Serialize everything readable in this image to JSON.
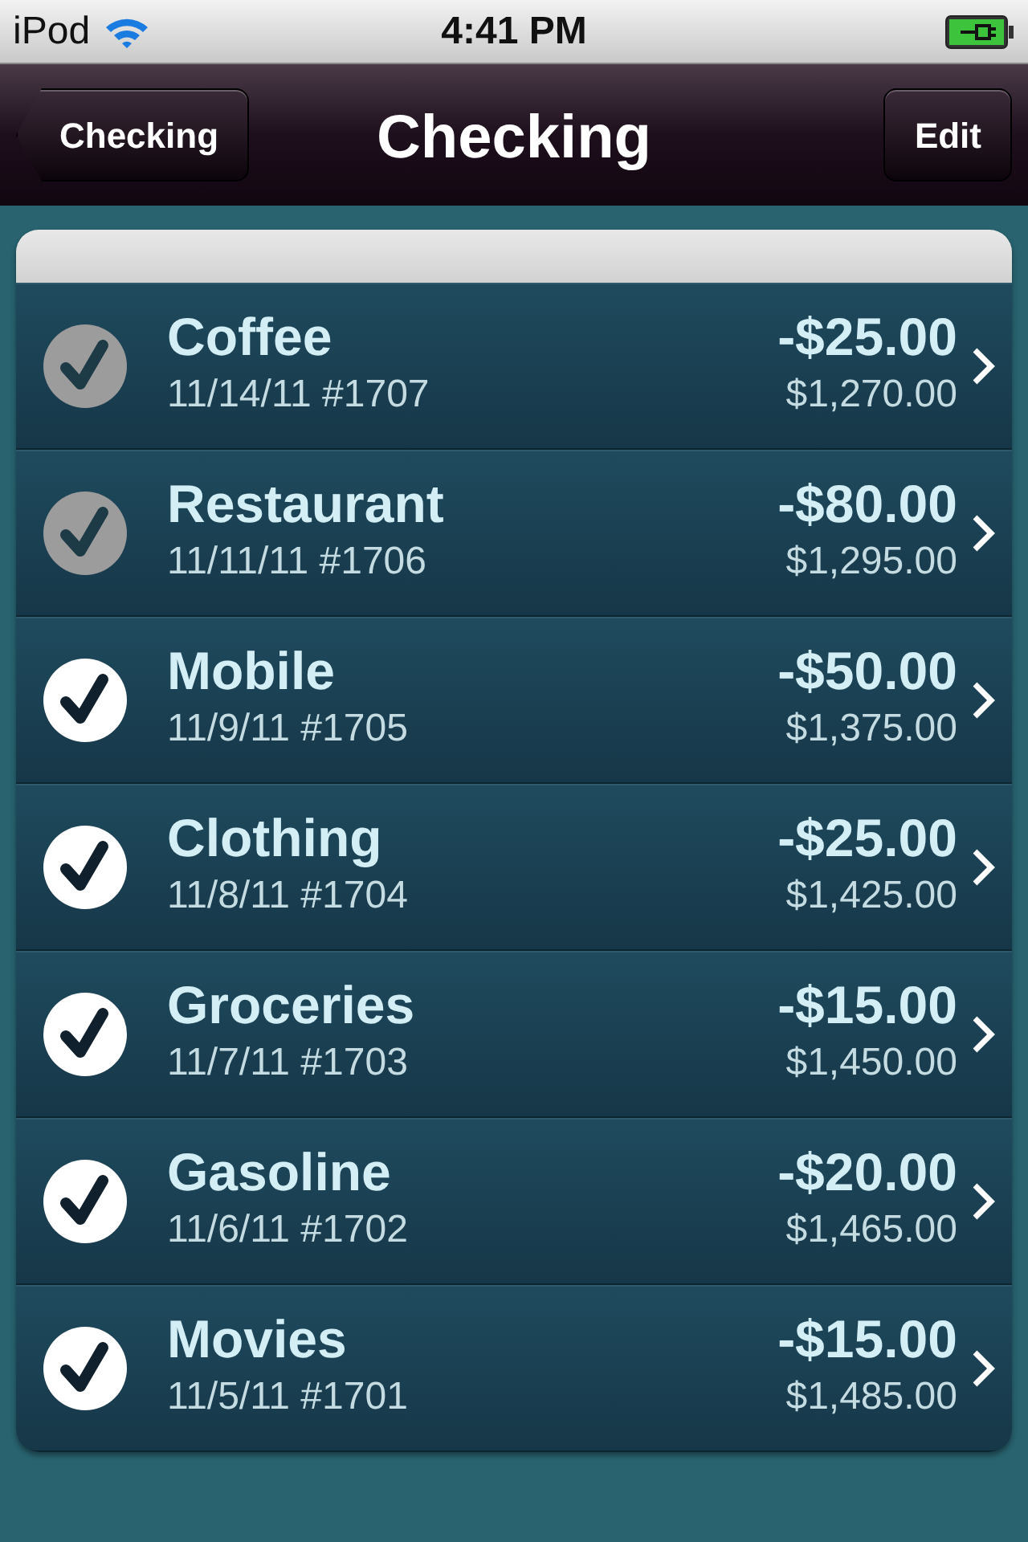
{
  "status_bar": {
    "carrier": "iPod",
    "time": "4:41 PM"
  },
  "nav_bar": {
    "back": "Checking",
    "title": "Checking",
    "edit": "Edit"
  },
  "transactions": [
    {
      "name": "Coffee",
      "date": "11/14/11 #1707",
      "amount": "-$25.00",
      "balance": "$1,270.00",
      "reconciled": true
    },
    {
      "name": "Restaurant",
      "date": "11/11/11 #1706",
      "amount": "-$80.00",
      "balance": "$1,295.00",
      "reconciled": true
    },
    {
      "name": "Mobile",
      "date": "11/9/11 #1705",
      "amount": "-$50.00",
      "balance": "$1,375.00",
      "reconciled": false
    },
    {
      "name": "Clothing",
      "date": "11/8/11 #1704",
      "amount": "-$25.00",
      "balance": "$1,425.00",
      "reconciled": false
    },
    {
      "name": "Groceries",
      "date": "11/7/11 #1703",
      "amount": "-$15.00",
      "balance": "$1,450.00",
      "reconciled": false
    },
    {
      "name": "Gasoline",
      "date": "11/6/11 #1702",
      "amount": "-$20.00",
      "balance": "$1,465.00",
      "reconciled": false
    },
    {
      "name": "Movies",
      "date": "11/5/11 #1701",
      "amount": "-$15.00",
      "balance": "$1,485.00",
      "reconciled": false
    }
  ]
}
